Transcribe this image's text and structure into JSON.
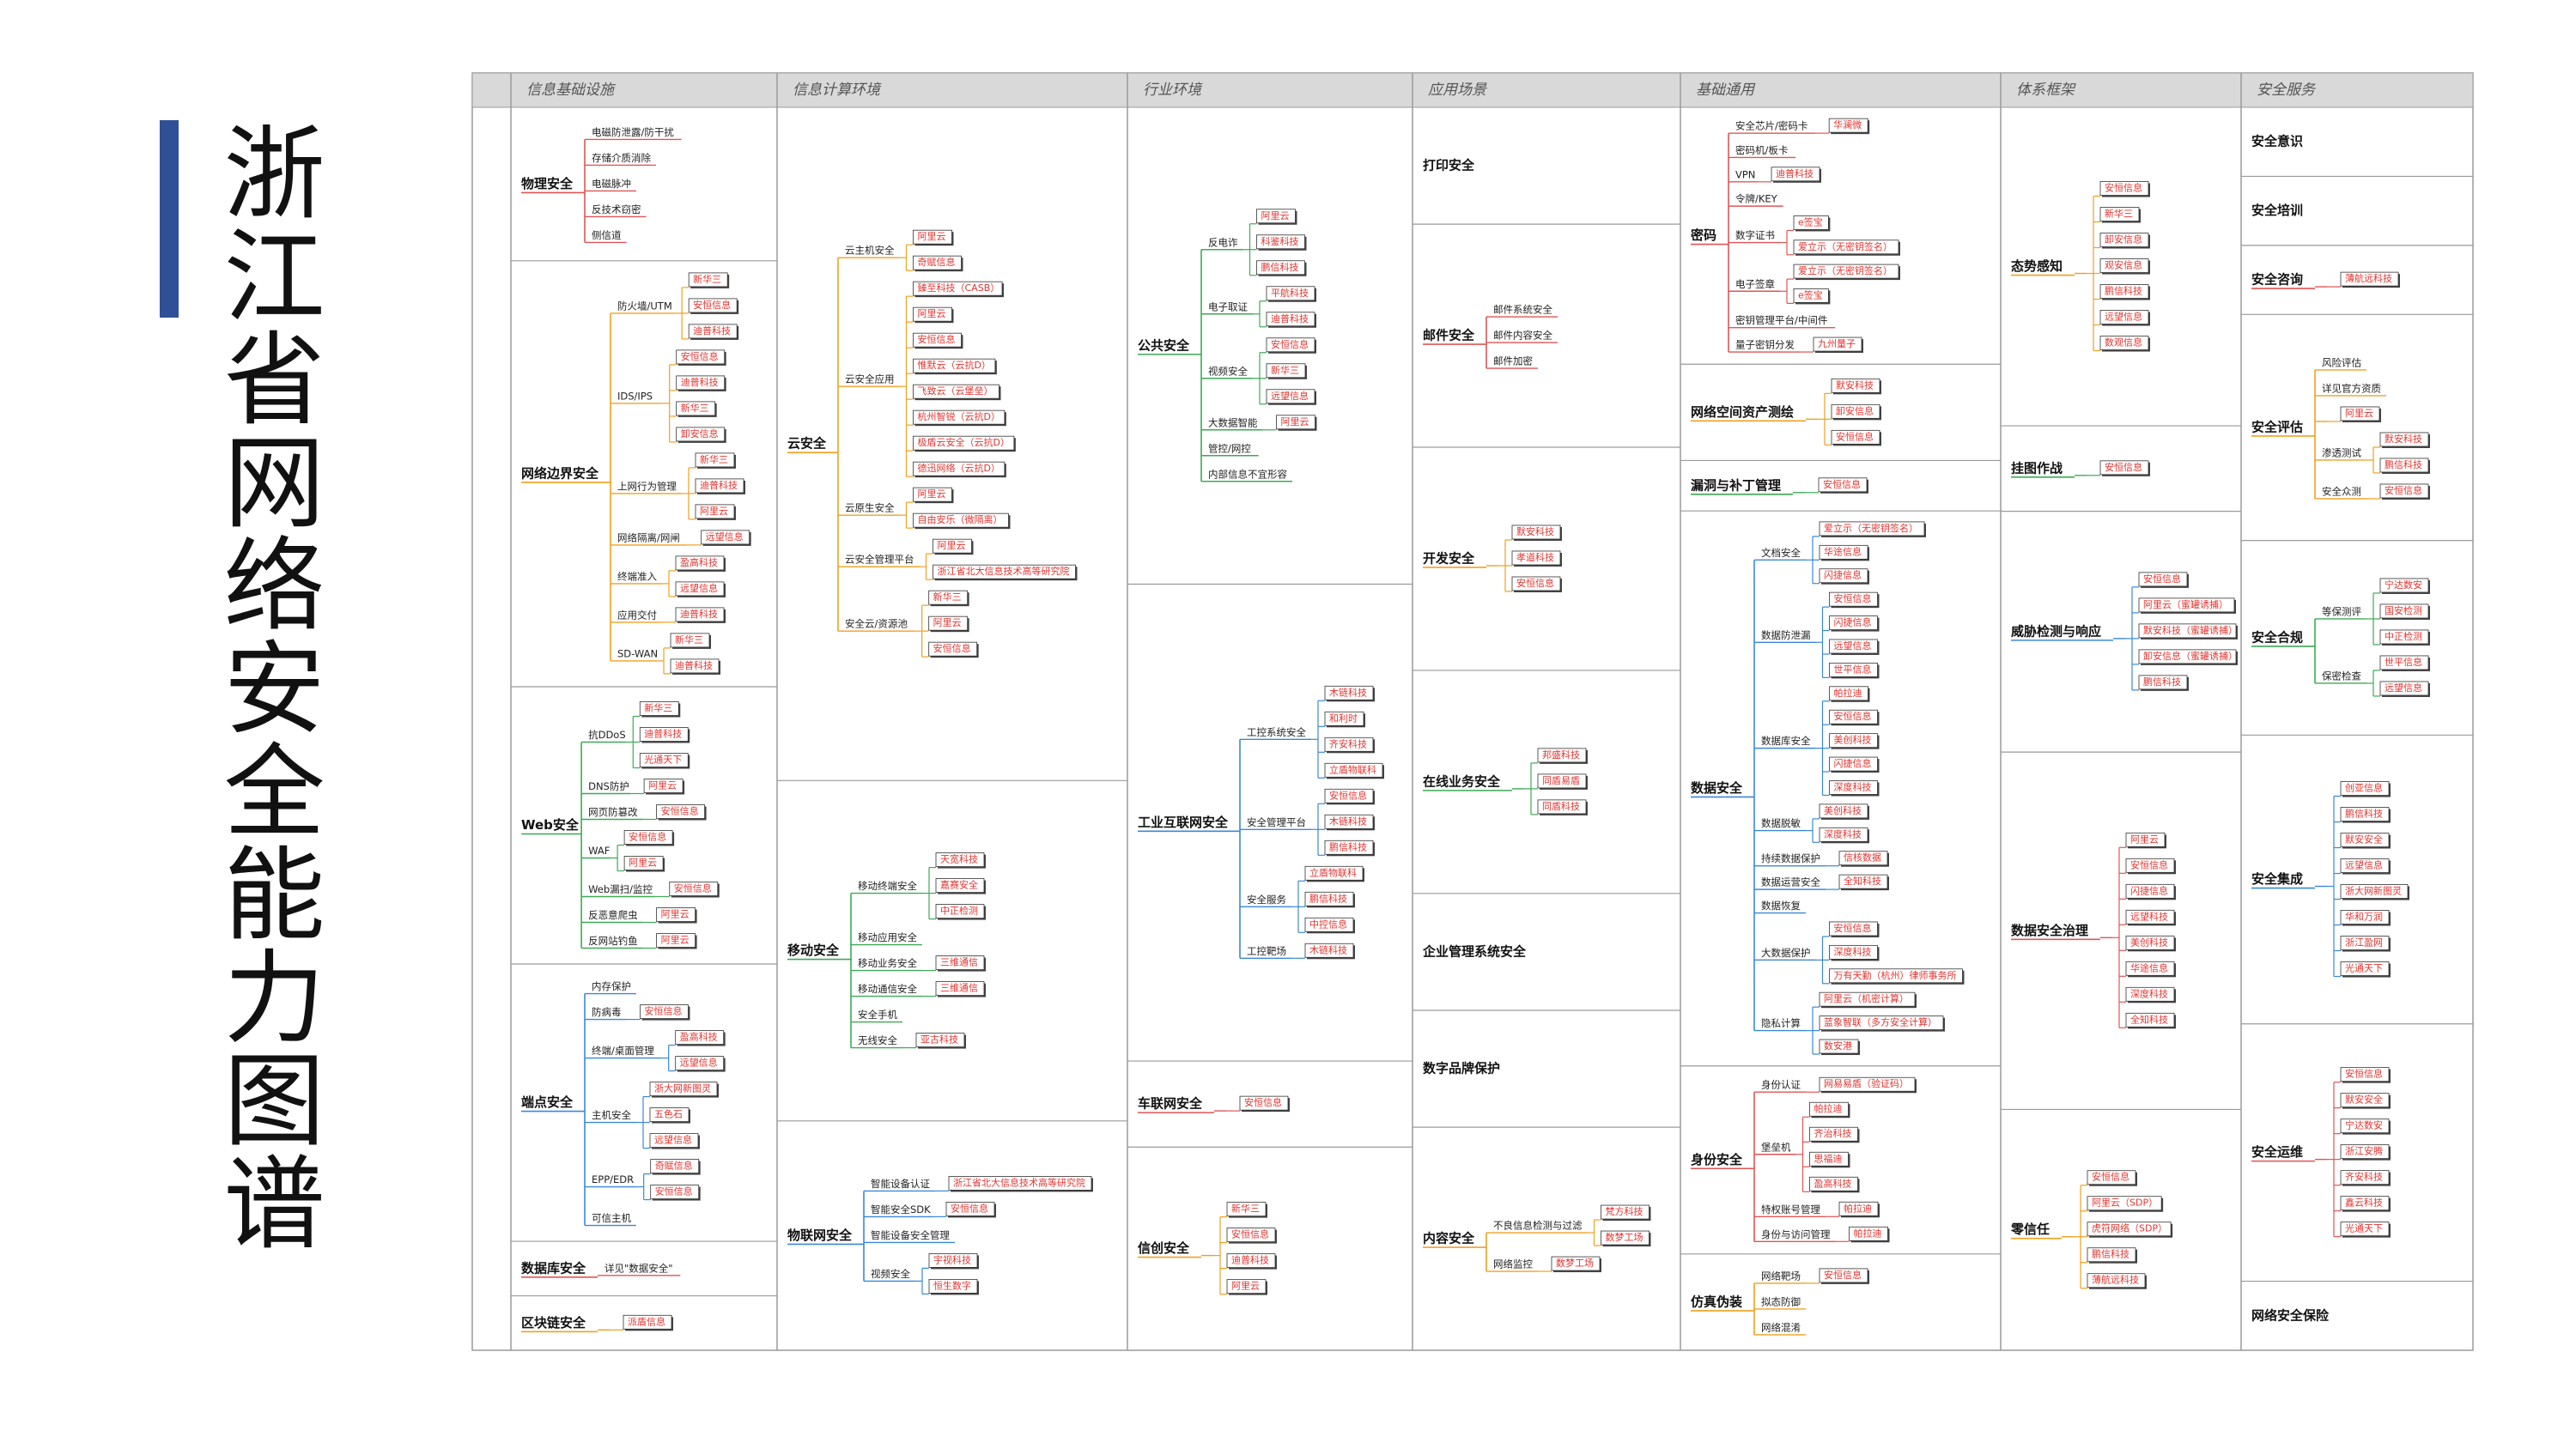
{
  "page": {
    "title": "浙江省网络安全能力图谱"
  },
  "columns": [
    "信息基础设施",
    "信息计算环境",
    "行业环境",
    "应用场景",
    "基础通用",
    "体系框架",
    "安全服务"
  ],
  "colors": {
    "accent": "#2f4f96",
    "vendor_text": "#e3342f",
    "branch_red": "#e05555",
    "branch_orange": "#f0a020",
    "branch_green": "#3daa55",
    "branch_blue": "#3a88d8",
    "grid": "#9a9a9a"
  },
  "col0": {
    "cats": [
      {
        "name": "物理安全",
        "groups": [
          {
            "label": "电磁防泄露/防干扰",
            "vendors": []
          },
          {
            "label": "存储介质消除",
            "vendors": []
          },
          {
            "label": "电磁脉冲",
            "vendors": []
          },
          {
            "label": "反技术窃密",
            "vendors": []
          },
          {
            "label": "侧信道",
            "vendors": []
          }
        ]
      },
      {
        "name": "网络边界安全",
        "groups": [
          {
            "label": "防火墙/UTM",
            "vendors": [
              "新华三",
              "安恒信息",
              "迪普科技"
            ]
          },
          {
            "label": "IDS/IPS",
            "vendors": [
              "安恒信息",
              "迪普科技",
              "新华三",
              "卸安信息"
            ]
          },
          {
            "label": "上网行为管理",
            "vendors": [
              "新华三",
              "迪普科技",
              "阿里云"
            ]
          },
          {
            "label": "网络隔离/网闸",
            "vendors": [
              "远望信息"
            ]
          },
          {
            "label": "终端准入",
            "vendors": [
              "盈高科技",
              "远望信息"
            ]
          },
          {
            "label": "应用交付",
            "vendors": [
              "迪普科技"
            ]
          },
          {
            "label": "SD-WAN",
            "vendors": [
              "新华三",
              "迪普科技"
            ]
          }
        ]
      },
      {
        "name": "Web安全",
        "groups": [
          {
            "label": "抗DDoS",
            "vendors": [
              "新华三",
              "迪普科技",
              "光通天下"
            ]
          },
          {
            "label": "DNS防护",
            "vendors": [
              "阿里云"
            ]
          },
          {
            "label": "网页防篡改",
            "vendors": [
              "安恒信息"
            ]
          },
          {
            "label": "WAF",
            "vendors": [
              "安恒信息",
              "阿里云"
            ]
          },
          {
            "label": "Web漏扫/监控",
            "vendors": [
              "安恒信息"
            ]
          },
          {
            "label": "反恶意爬虫",
            "vendors": [
              "阿里云"
            ]
          },
          {
            "label": "反网站钓鱼",
            "vendors": [
              "阿里云"
            ]
          }
        ]
      },
      {
        "name": "端点安全",
        "groups": [
          {
            "label": "内存保护",
            "vendors": []
          },
          {
            "label": "防病毒",
            "vendors": [
              "安恒信息"
            ]
          },
          {
            "label": "终端/桌面管理",
            "vendors": [
              "盈高科技",
              "远望信息"
            ]
          },
          {
            "label": "主机安全",
            "vendors": [
              "浙大网新图灵",
              "五色石",
              "远望信息"
            ]
          },
          {
            "label": "EPP/EDR",
            "vendors": [
              "奇赋信息",
              "安恒信息"
            ]
          },
          {
            "label": "可信主机",
            "vendors": []
          }
        ]
      },
      {
        "name": "数据库安全",
        "groups": [
          {
            "label": "详见\"数据安全\"",
            "vendors": []
          }
        ]
      },
      {
        "name": "区块链安全",
        "groups": [
          {
            "label": "",
            "vendors": [
              "派盾信息"
            ]
          }
        ]
      }
    ]
  },
  "col1": {
    "cats": [
      {
        "name": "云安全",
        "groups": [
          {
            "label": "云主机安全",
            "vendors": [
              "阿里云",
              "奇赋信息"
            ]
          },
          {
            "label": "云安全应用",
            "vendors": [
              "臻至科技（CASB）",
              "阿里云",
              "安恒信息",
              "惟默云（云抗D）",
              "飞致云（云堡垒）",
              "杭州智锐（云抗D）",
              "极盾云安全（云抗D）",
              "德迅网络（云抗D）"
            ]
          },
          {
            "label": "云原生安全",
            "vendors": [
              "阿里云",
              "自由安乐（微隔离）"
            ]
          },
          {
            "label": "云安全管理平台",
            "vendors": [
              "阿里云",
              "浙江省北大信息技术高等研究院"
            ]
          },
          {
            "label": "安全云/资源池",
            "vendors": [
              "新华三",
              "阿里云",
              "安恒信息"
            ]
          }
        ]
      },
      {
        "name": "移动安全",
        "groups": [
          {
            "label": "移动终端安全",
            "vendors": [
              "天宽科技",
              "嘉赛安全",
              "中正检测"
            ]
          },
          {
            "label": "移动应用安全",
            "vendors": []
          },
          {
            "label": "移动业务安全",
            "vendors": [
              "三维通信"
            ]
          },
          {
            "label": "移动通信安全",
            "vendors": [
              "三维通信"
            ]
          },
          {
            "label": "安全手机",
            "vendors": []
          },
          {
            "label": "无线安全",
            "vendors": [
              "亚古科技"
            ]
          }
        ]
      },
      {
        "name": "物联网安全",
        "groups": [
          {
            "label": "智能设备认证",
            "vendors": [
              "浙江省北大信息技术高等研究院"
            ]
          },
          {
            "label": "智能安全SDK",
            "vendors": [
              "安恒信息"
            ]
          },
          {
            "label": "智能设备安全管理",
            "vendors": []
          },
          {
            "label": "视频安全",
            "vendors": [
              "宇视科技",
              "恒生数字"
            ]
          }
        ]
      }
    ]
  },
  "col2": {
    "cats": [
      {
        "name": "公共安全",
        "groups": [
          {
            "label": "反电诈",
            "vendors": [
              "阿里云",
              "科鉴科技",
              "鹏信科技"
            ]
          },
          {
            "label": "电子取证",
            "vendors": [
              "平航科技",
              "迪普科技"
            ]
          },
          {
            "label": "视频安全",
            "vendors": [
              "安恒信息",
              "新华三",
              "远望信息"
            ]
          },
          {
            "label": "大数据智能",
            "vendors": [
              "阿里云"
            ]
          },
          {
            "label": "管控/网控",
            "vendors": []
          },
          {
            "label": "内部信息不宜形容",
            "vendors": []
          }
        ]
      },
      {
        "name": "工业互联网安全",
        "groups": [
          {
            "label": "工控系统安全",
            "vendors": [
              "木链科技",
              "和利时",
              "齐安科技",
              "立盾物联科"
            ]
          },
          {
            "label": "安全管理平台",
            "vendors": [
              "安恒信息",
              "木链科技",
              "鹏信科技"
            ]
          },
          {
            "label": "安全服务",
            "vendors": [
              "立盾物联科",
              "鹏信科技",
              "中控信息"
            ]
          },
          {
            "label": "工控靶场",
            "vendors": [
              "木链科技"
            ]
          }
        ]
      },
      {
        "name": "车联网安全",
        "groups": [
          {
            "label": "",
            "vendors": [
              "安恒信息"
            ]
          }
        ]
      },
      {
        "name": "信创安全",
        "groups": [
          {
            "label": "",
            "vendors": [
              "新华三",
              "安恒信息",
              "迪普科技",
              "阿里云"
            ]
          }
        ]
      }
    ]
  },
  "col3": {
    "cats": [
      {
        "name": "打印安全",
        "groups": []
      },
      {
        "name": "邮件安全",
        "groups": [
          {
            "label": "邮件系统安全",
            "vendors": []
          },
          {
            "label": "邮件内容安全",
            "vendors": []
          },
          {
            "label": "邮件加密",
            "vendors": []
          }
        ]
      },
      {
        "name": "开发安全",
        "groups": [
          {
            "label": "",
            "vendors": [
              "默安科技",
              "孝道科技",
              "安恒信息"
            ]
          }
        ]
      },
      {
        "name": "在线业务安全",
        "groups": [
          {
            "label": "",
            "vendors": [
              "邦盛科技",
              "同盾易盾",
              "同盾科技"
            ]
          }
        ]
      },
      {
        "name": "企业管理系统安全",
        "groups": []
      },
      {
        "name": "数字品牌保护",
        "groups": []
      },
      {
        "name": "内容安全",
        "groups": [
          {
            "label": "不良信息检测与过滤",
            "vendors": [
              "梵方科技",
              "数梦工场"
            ]
          },
          {
            "label": "网络监控",
            "vendors": [
              "数梦工场"
            ]
          }
        ]
      }
    ]
  },
  "col4": {
    "cats": [
      {
        "name": "密码",
        "groups": [
          {
            "label": "安全芯片/密码卡",
            "vendors": [
              "华澜微"
            ]
          },
          {
            "label": "密码机/板卡",
            "vendors": []
          },
          {
            "label": "VPN",
            "vendors": [
              "迪普科技"
            ]
          },
          {
            "label": "令牌/KEY",
            "vendors": []
          },
          {
            "label": "数字证书",
            "vendors": [
              "e签宝",
              "爱立示（无密钥签名）"
            ]
          },
          {
            "label": "电子签章",
            "vendors": [
              "爱立示（无密钥签名）",
              "e签宝"
            ]
          },
          {
            "label": "密钥管理平台/中间件",
            "vendors": []
          },
          {
            "label": "量子密钥分发",
            "vendors": [
              "九州量子"
            ]
          }
        ]
      },
      {
        "name": "网络空间资产测绘",
        "groups": [
          {
            "label": "",
            "vendors": [
              "默安科技",
              "卸安信息",
              "安恒信息"
            ]
          }
        ]
      },
      {
        "name": "漏洞与补丁管理",
        "groups": [
          {
            "label": "",
            "vendors": [
              "安恒信息"
            ]
          }
        ]
      },
      {
        "name": "数据安全",
        "groups": [
          {
            "label": "文档安全",
            "vendors": [
              "爱立示（无密钥签名）",
              "华途信息",
              "闪捷信息"
            ]
          },
          {
            "label": "数据防泄漏",
            "vendors": [
              "安恒信息",
              "闪捷信息",
              "远望信息",
              "世平信息"
            ]
          },
          {
            "label": "数据库安全",
            "vendors": [
              "帕拉迪",
              "安恒信息",
              "美创科技",
              "闪捷信息",
              "深度科技"
            ]
          },
          {
            "label": "数据脱敏",
            "vendors": [
              "美创科技",
              "深度科技"
            ]
          },
          {
            "label": "持续数据保护",
            "vendors": [
              "信核数据"
            ]
          },
          {
            "label": "数据运营安全",
            "vendors": [
              "全知科技"
            ]
          },
          {
            "label": "数据恢复",
            "vendors": []
          },
          {
            "label": "大数据保护",
            "vendors": [
              "安恒信息",
              "深度科技",
              "万有天勤（杭州）律师事务所"
            ]
          },
          {
            "label": "隐私计算",
            "vendors": [
              "阿里云（机密计算）",
              "蓝象智联（多方安全计算）",
              "数安港"
            ]
          }
        ]
      },
      {
        "name": "身份安全",
        "groups": [
          {
            "label": "身份认证",
            "vendors": [
              "网易易盾（验证码）"
            ]
          },
          {
            "label": "堡垒机",
            "vendors": [
              "帕拉迪",
              "齐治科技",
              "思福迪",
              "盈高科技"
            ]
          },
          {
            "label": "特权账号管理",
            "vendors": [
              "帕拉迪"
            ]
          },
          {
            "label": "身份与访问管理",
            "vendors": [
              "帕拉迪"
            ]
          }
        ]
      },
      {
        "name": "仿真伪装",
        "groups": [
          {
            "label": "网络靶场",
            "vendors": [
              "安恒信息"
            ]
          },
          {
            "label": "拟态防御",
            "vendors": []
          },
          {
            "label": "网络混淆",
            "vendors": []
          }
        ]
      }
    ]
  },
  "col5": {
    "cats": [
      {
        "name": "态势感知",
        "groups": [
          {
            "label": "",
            "vendors": [
              "安恒信息",
              "新华三",
              "卸安信息",
              "观安信息",
              "鹏信科技",
              "远望信息",
              "数观信息"
            ]
          }
        ]
      },
      {
        "name": "挂图作战",
        "groups": [
          {
            "label": "",
            "vendors": [
              "安恒信息"
            ]
          }
        ]
      },
      {
        "name": "威胁检测与响应",
        "groups": [
          {
            "label": "",
            "vendors": [
              "安恒信息",
              "阿里云（蜜罐诱捕）",
              "默安科技（蜜罐诱捕）",
              "卸安信息（蜜罐诱捕）",
              "鹏信科技"
            ]
          }
        ]
      },
      {
        "name": "数据安全治理",
        "groups": [
          {
            "label": "",
            "vendors": [
              "阿里云",
              "安恒信息",
              "闪捷信息",
              "远望科技",
              "美创科技",
              "华途信息",
              "深度科技",
              "全知科技"
            ]
          }
        ]
      },
      {
        "name": "零信任",
        "groups": [
          {
            "label": "",
            "vendors": [
              "安恒信息",
              "阿里云（SDP）",
              "虎符网络（SDP）",
              "鹏信科技",
              "薄航远科技"
            ]
          }
        ]
      }
    ]
  },
  "col6": {
    "cats": [
      {
        "name": "安全意识",
        "groups": []
      },
      {
        "name": "安全培训",
        "groups": []
      },
      {
        "name": "安全咨询",
        "groups": [
          {
            "label": "",
            "vendors": [
              "薄航远科技"
            ]
          }
        ]
      },
      {
        "name": "安全评估",
        "groups": [
          {
            "label": "风险评估",
            "vendors": []
          },
          {
            "label": "详见官方资质",
            "vendors": []
          },
          {
            "label": "",
            "vendors": [
              "阿里云"
            ]
          },
          {
            "label": "渗透测试",
            "vendors": [
              "默安科技",
              "鹏信科技"
            ]
          },
          {
            "label": "安全众测",
            "vendors": [
              "安恒信息"
            ]
          }
        ]
      },
      {
        "name": "安全合规",
        "groups": [
          {
            "label": "等保测评",
            "vendors": [
              "宁达数安",
              "国安检测",
              "中正检测"
            ]
          },
          {
            "label": "保密检查",
            "vendors": [
              "世平信息",
              "远望信息"
            ]
          }
        ]
      },
      {
        "name": "安全集成",
        "groups": [
          {
            "label": "",
            "vendors": [
              "创亚信息",
              "鹏信科技",
              "默安安全",
              "远望信息",
              "浙大网新图灵",
              "华和万润",
              "浙江盈网",
              "光通天下"
            ]
          }
        ]
      },
      {
        "name": "安全运维",
        "groups": [
          {
            "label": "",
            "vendors": [
              "安恒信息",
              "默安安全",
              "宁达数安",
              "浙江安腾",
              "齐安科技",
              "鑫云科技",
              "光通天下"
            ]
          }
        ]
      },
      {
        "name": "网络安全保险",
        "groups": []
      }
    ]
  }
}
